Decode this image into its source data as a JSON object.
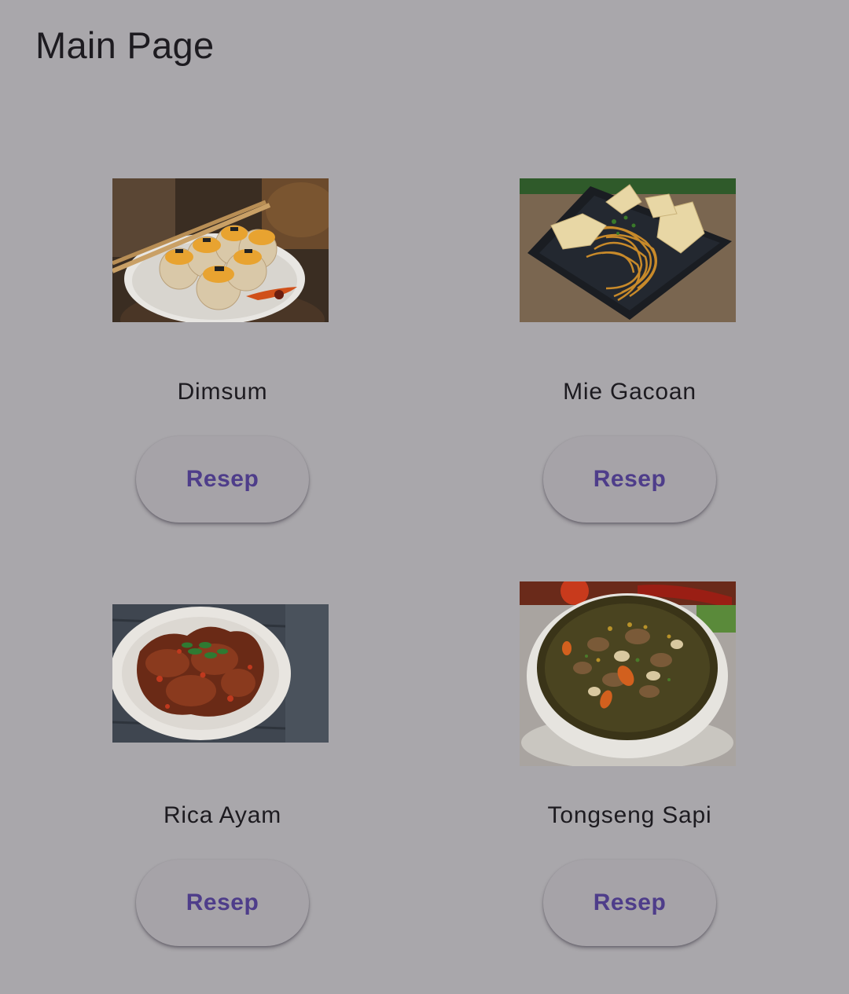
{
  "app_bar": {
    "title": "Main Page"
  },
  "menu": [
    {
      "name": "Dimsum",
      "button_label": "Resep",
      "image": "dimsum-photo"
    },
    {
      "name": "Mie Gacoan",
      "button_label": "Resep",
      "image": "mie-gacoan-photo"
    },
    {
      "name": "Rica Ayam",
      "button_label": "Resep",
      "image": "rica-ayam-photo"
    },
    {
      "name": "Tongseng Sapi",
      "button_label": "Resep",
      "image": "tongseng-sapi-photo"
    }
  ],
  "colors": {
    "background": "#a9a7ab",
    "button_background": "#a6a3a8",
    "button_text": "#4e3d8a",
    "text": "#1d1b20"
  }
}
